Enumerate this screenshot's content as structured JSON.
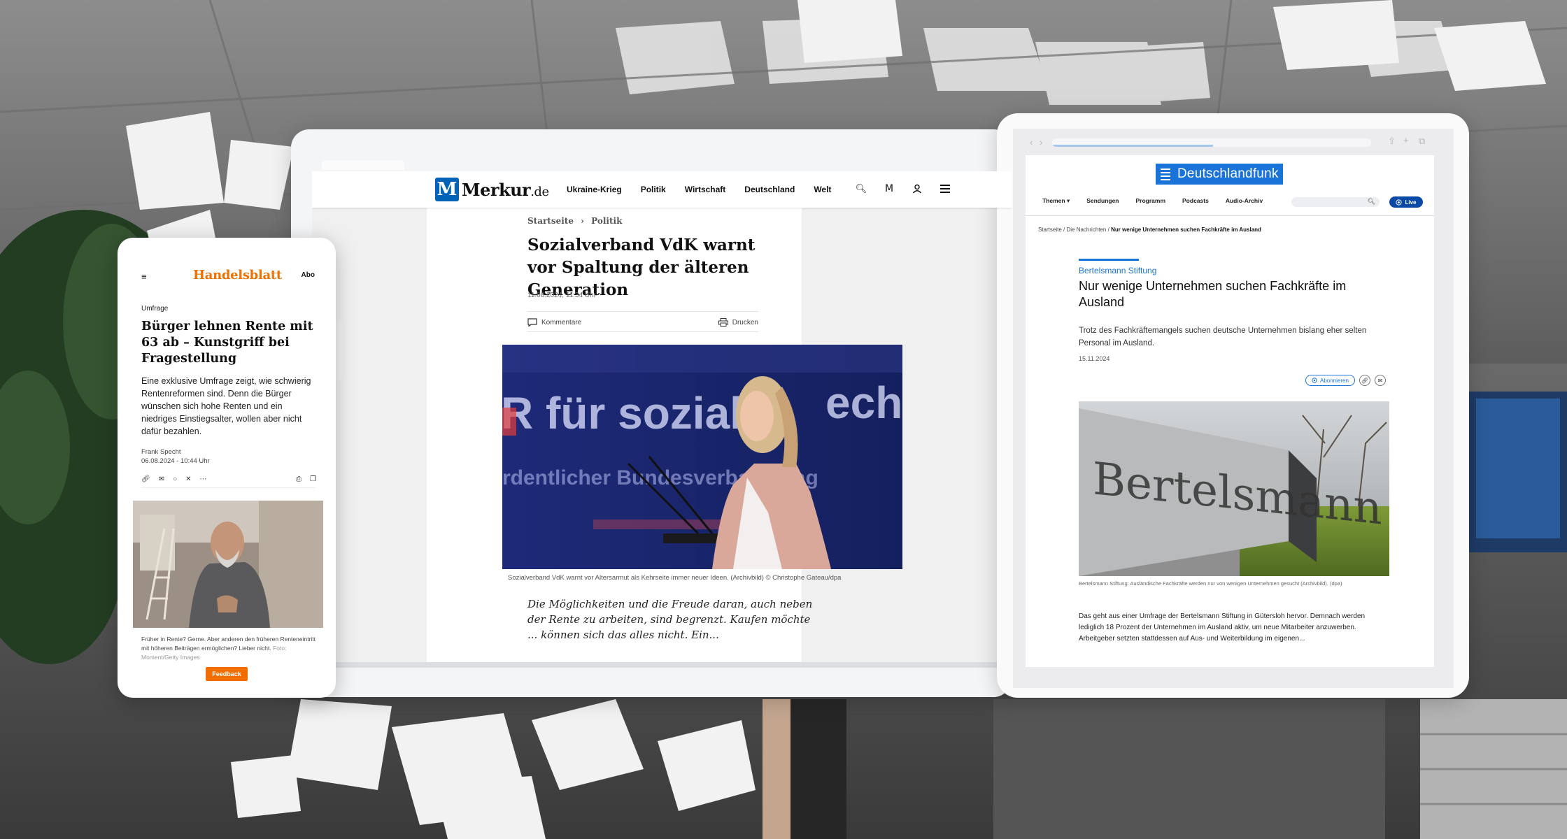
{
  "merkur": {
    "logo_mark": "M",
    "logo_name": "Merkur",
    "logo_tld": ".de",
    "nav": [
      "Ukraine-Krieg",
      "Politik",
      "Wirtschaft",
      "Deutschland",
      "Welt"
    ],
    "icons": [
      "search-icon",
      "m-icon",
      "user-icon",
      "menu-icon"
    ],
    "breadcrumb_home": "Startseite",
    "breadcrumb_sep": "›",
    "breadcrumb_section": "Politik",
    "title": "Sozialverband VdK warnt vor Spaltung der älteren Generation",
    "date": "11.08.2024, 11:34 Uhr",
    "comments_label": "Kommentare",
    "print_label": "Drucken",
    "image_slogan_1": "R für soziale",
    "image_slogan_2": "echt",
    "image_subline": "rdentlicher Bundesverbandstag",
    "image_caption": "Sozialverband VdK warnt vor Altersarmut als Kehrseite immer neuer Ideen. (Archivbild) © Christophe Gateau/dpa",
    "lead": "Die Möglichkeiten und die Freude daran, auch neben der Rente zu arbeiten, sind begrenzt. Kaufen möchte ... können sich das alles nicht. Ein..."
  },
  "dlf": {
    "logo": "Deutschlandfunk",
    "nav": [
      "Themen ▾",
      "Sendungen",
      "Programm",
      "Podcasts",
      "Audio-Archiv"
    ],
    "live_label": "Live",
    "breadcrumb_home": "Startseite",
    "breadcrumb_news": "Die Nachrichten",
    "breadcrumb_current": "Nur wenige Unternehmen suchen Fachkräfte im Ausland",
    "kicker": "Bertelsmann Stiftung",
    "title": "Nur wenige Unternehmen suchen Fachkräfte im Ausland",
    "teaser": "Trotz des Fachkräftemangels suchen deutsche Unternehmen bislang eher selten Personal im Ausland.",
    "date": "15.11.2024",
    "subscribe_label": "Abonnieren",
    "image_sign_text": "Bertelsmann Stift",
    "image_caption": "Bertelsmann Stiftung: Ausländische Fachkräfte werden nur von wenigen Unternehmen gesucht (Archivbild). (dpa)",
    "body": "Das geht aus einer Umfrage der Bertelsmann Stiftung in Gütersloh hervor. Demnach werden lediglich 18 Prozent der Unternehmen im Ausland aktiv, um neue Mitarbeiter anzuwerben. Arbeitgeber setzten stattdessen auf Aus- und Weiterbildung im eigenen..."
  },
  "handelsblatt": {
    "logo": "Handelsblatt",
    "abo_label": "Abo",
    "kicker": "Umfrage",
    "title": "Bürger lehnen Rente mit 63 ab – Kunstgriff bei Fragestellung",
    "teaser": "Eine exklusive Umfrage zeigt, wie schwierig Rentenreformen sind. Denn die Bürger wünschen sich hohe Renten und ein niedriges Einstiegsalter, wollen aber nicht dafür bezahlen.",
    "author": "Frank Specht",
    "date": "06.08.2024 - 10:44 Uhr",
    "caption": "Früher in Rente? Gerne. Aber anderen den früheren Renteneintritt mit höheren Beiträgen ermöglichen? Lieber nicht.",
    "caption_credit": "Foto: Moment/Getty Images",
    "feedback_label": "Feedback"
  },
  "colors": {
    "merkur_blue": "#0063b5",
    "dlf_blue": "#1a73d9",
    "handelsblatt_orange": "#ee7203",
    "feedback_orange": "#f26d00"
  }
}
